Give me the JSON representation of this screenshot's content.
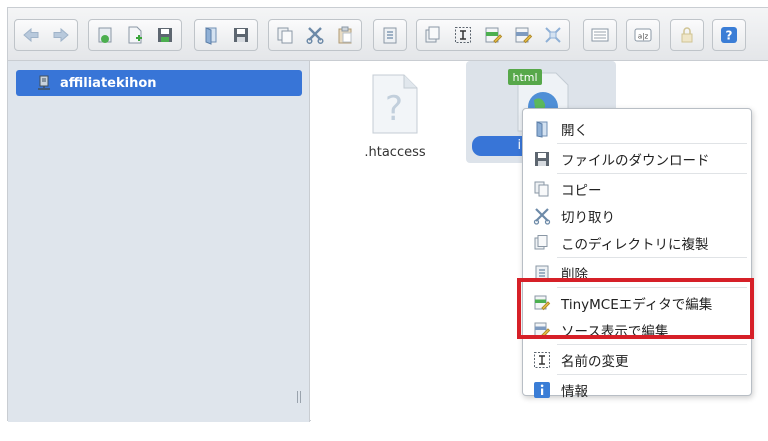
{
  "toolbar": {
    "groups": [
      [
        "back-icon",
        "forward-icon"
      ],
      [
        "home-icon",
        "new-file-icon",
        "save-icon"
      ],
      [
        "open-icon",
        "download-icon"
      ],
      [
        "copy-icon",
        "cut-icon",
        "paste-icon"
      ],
      [
        "delete-icon"
      ],
      [
        "duplicate-icon",
        "rename-icon",
        "edit-icon",
        "edit-source-icon",
        "resize-icon"
      ],
      [
        "view-icon"
      ],
      [
        "sort-icon"
      ],
      [
        "lock-icon"
      ],
      [
        "help-icon"
      ]
    ]
  },
  "sidebar": {
    "items": [
      {
        "label": "affiliatekihon",
        "icon": "server-icon",
        "selected": true
      }
    ]
  },
  "files": [
    {
      "name": ".htaccess",
      "icon": "unknown-file-icon"
    },
    {
      "name": "index.html",
      "visible_name": "inc",
      "icon": "html-file-icon",
      "icon_badge": "html",
      "selected": true
    }
  ],
  "context_menu": {
    "items": [
      {
        "label": "開く",
        "icon": "open-icon"
      },
      {
        "label": "ファイルのダウンロード",
        "icon": "download-icon"
      },
      {
        "label": "コピー",
        "icon": "copy-icon"
      },
      {
        "label": "切り取り",
        "icon": "cut-icon"
      },
      {
        "label": "このディレクトリに複製",
        "icon": "duplicate-icon"
      },
      {
        "label": "削除",
        "icon": "delete-icon"
      },
      {
        "label": "TinyMCEエディタで編集",
        "icon": "edit-icon"
      },
      {
        "label": "ソース表示で編集",
        "icon": "edit-source-icon"
      },
      {
        "label": "名前の変更",
        "icon": "rename-icon"
      },
      {
        "label": "情報",
        "icon": "info-icon"
      }
    ]
  },
  "colors": {
    "selection": "#3875d7",
    "sidebar_bg": "#dfe5ec",
    "highlight_box": "#d62028"
  }
}
